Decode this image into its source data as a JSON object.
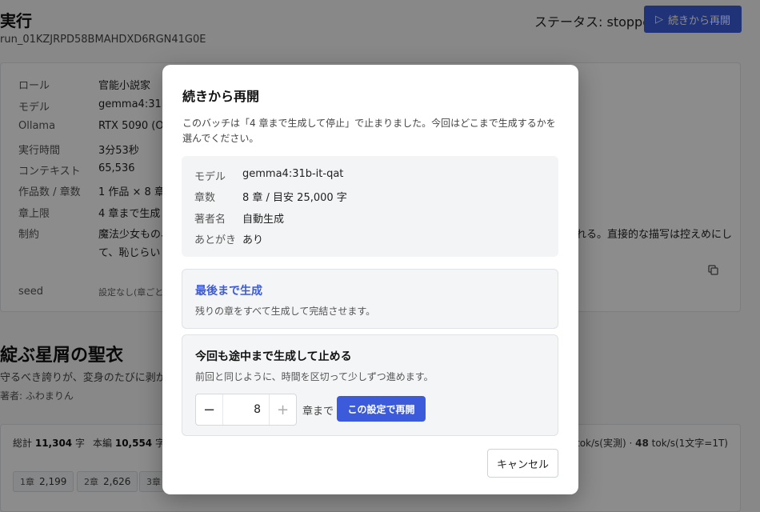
{
  "header": {
    "title": "実行",
    "run_id": "run_01KZJRPD58BMAHDXD6RGN41G0E",
    "status": "ステータス: stopped",
    "resume_button": "続きから再開",
    "play_icon": "▷"
  },
  "info": {
    "rows": [
      {
        "key": "ロール",
        "value": "官能小説家"
      },
      {
        "key": "モデル",
        "value": "gemma4:31b"
      },
      {
        "key": "Ollama",
        "value": "RTX 5090 (Ol"
      },
      {
        "key": "実行時間",
        "value": "3分53秒"
      },
      {
        "key": "コンテキスト",
        "value": "65,536"
      },
      {
        "key": "作品数 / 章数",
        "value": "1 作品 × 8 章"
      },
      {
        "key": "章上限",
        "value": "4 章まで生成し"
      },
      {
        "key": "制約",
        "value": "魔法少女もの、"
      }
    ],
    "constraint_tail": "れる。直接的な描写は控えめにし",
    "constraint_line2": "て、恥じらいと気",
    "seed_key": "seed",
    "seed_value": "設定なし(章ごとに"
  },
  "work": {
    "title": "綻ぶ星屑の聖衣",
    "subtitle": "守るべき誇りが、変身のたびに剥が",
    "author": "著者: ふわまりん"
  },
  "stats": {
    "total_label": "総計",
    "total_value": "11,304",
    "total_unit": "字",
    "body_label": "本編",
    "body_value": "10,554",
    "body_unit": "字",
    "speed_prefix": "tok/s(実測) ·",
    "speed_value": "48",
    "speed_suffix": "tok/s(1文字=1T)",
    "chips": [
      {
        "ch": "1章",
        "count": "2,199"
      },
      {
        "ch": "2章",
        "count": "2,626"
      },
      {
        "ch": "3章",
        "count": ""
      }
    ]
  },
  "modal": {
    "title": "続きから再開",
    "description": "このバッチは「4 章まで生成して停止」で止まりました。今回はどこまで生成するかを選んでください。",
    "summary": [
      {
        "key": "モデル",
        "value": "gemma4:31b-it-qat"
      },
      {
        "key": "章数",
        "value": "8 章 / 目安 25,000 字"
      },
      {
        "key": "著者名",
        "value": "自動生成"
      },
      {
        "key": "あとがき",
        "value": "あり"
      }
    ],
    "option_full": {
      "title": "最後まで生成",
      "desc": "残りの章をすべて生成して完結させます。"
    },
    "option_partial": {
      "title": "今回も途中まで生成して止める",
      "desc": "前回と同じように、時間を区切って少しずつ進めます。",
      "value": "8",
      "minus": "−",
      "plus": "+",
      "suffix": "章まで",
      "apply": "この設定で再開"
    },
    "cancel": "キャンセル"
  }
}
